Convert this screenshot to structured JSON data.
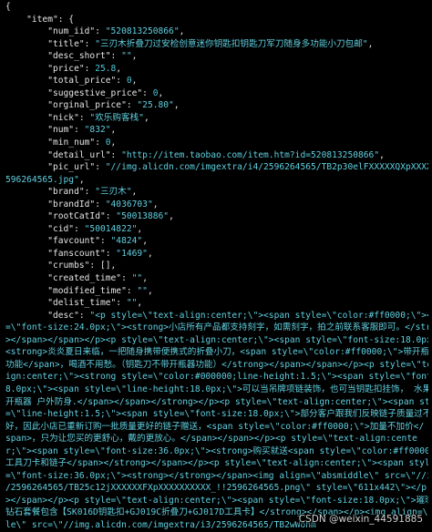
{
  "code_lines": [
    {
      "segs": [
        {
          "t": "{",
          "c": ""
        }
      ]
    },
    {
      "segs": [
        {
          "t": "    \"item\": {",
          "c": ""
        }
      ]
    },
    {
      "segs": [
        {
          "t": "        \"num_iid\": ",
          "c": ""
        },
        {
          "t": "\"520813250866\"",
          "c": "c-str"
        },
        {
          "t": ",",
          "c": ""
        }
      ]
    },
    {
      "segs": [
        {
          "t": "        \"title\": ",
          "c": ""
        },
        {
          "t": "\"三刃木折叠刀过安检创意迷你钥匙扣钥匙刀军刀随身多功能小刀包邮\"",
          "c": "c-str"
        },
        {
          "t": ",",
          "c": ""
        }
      ]
    },
    {
      "segs": [
        {
          "t": "        \"desc_short\": ",
          "c": ""
        },
        {
          "t": "\"\"",
          "c": "c-str"
        },
        {
          "t": ",",
          "c": ""
        }
      ]
    },
    {
      "segs": [
        {
          "t": "        \"price\": ",
          "c": ""
        },
        {
          "t": "25.8",
          "c": "c-num"
        },
        {
          "t": ",",
          "c": ""
        }
      ]
    },
    {
      "segs": [
        {
          "t": "        \"total_price\": ",
          "c": ""
        },
        {
          "t": "0",
          "c": "c-num"
        },
        {
          "t": ",",
          "c": ""
        }
      ]
    },
    {
      "segs": [
        {
          "t": "        \"suggestive_price\": ",
          "c": ""
        },
        {
          "t": "0",
          "c": "c-num"
        },
        {
          "t": ",",
          "c": ""
        }
      ]
    },
    {
      "segs": [
        {
          "t": "        \"orginal_price\": ",
          "c": ""
        },
        {
          "t": "\"25.80\"",
          "c": "c-str"
        },
        {
          "t": ",",
          "c": ""
        }
      ]
    },
    {
      "segs": [
        {
          "t": "        \"nick\": ",
          "c": ""
        },
        {
          "t": "\"欢乐购客栈\"",
          "c": "c-str"
        },
        {
          "t": ",",
          "c": ""
        }
      ]
    },
    {
      "segs": [
        {
          "t": "        \"num\": ",
          "c": ""
        },
        {
          "t": "\"832\"",
          "c": "c-str"
        },
        {
          "t": ",",
          "c": ""
        }
      ]
    },
    {
      "segs": [
        {
          "t": "        \"min_num\": ",
          "c": ""
        },
        {
          "t": "0",
          "c": "c-num"
        },
        {
          "t": ",",
          "c": ""
        }
      ]
    },
    {
      "segs": [
        {
          "t": "        \"detail_url\": ",
          "c": ""
        },
        {
          "t": "\"http://item.taobao.com/item.htm?id=520813250866\"",
          "c": "c-str"
        },
        {
          "t": ",",
          "c": ""
        }
      ]
    },
    {
      "segs": [
        {
          "t": "        \"pic_url\": ",
          "c": ""
        },
        {
          "t": "\"//img.alicdn.com/imgextra/i4/2596264565/TB2p30elFXXXXXQXpXXXXXXXXXX_!!2",
          "c": "c-str"
        }
      ]
    },
    {
      "segs": [
        {
          "t": "596264565.jpg\"",
          "c": "c-str"
        },
        {
          "t": ",",
          "c": ""
        }
      ]
    },
    {
      "segs": [
        {
          "t": "        \"brand\": ",
          "c": ""
        },
        {
          "t": "\"三刃木\"",
          "c": "c-str"
        },
        {
          "t": ",",
          "c": ""
        }
      ]
    },
    {
      "segs": [
        {
          "t": "        \"brandId\": ",
          "c": ""
        },
        {
          "t": "\"4036703\"",
          "c": "c-str"
        },
        {
          "t": ",",
          "c": ""
        }
      ]
    },
    {
      "segs": [
        {
          "t": "        \"rootCatId\": ",
          "c": ""
        },
        {
          "t": "\"50013886\"",
          "c": "c-str"
        },
        {
          "t": ",",
          "c": ""
        }
      ]
    },
    {
      "segs": [
        {
          "t": "        \"cid\": ",
          "c": ""
        },
        {
          "t": "\"50014822\"",
          "c": "c-str"
        },
        {
          "t": ",",
          "c": ""
        }
      ]
    },
    {
      "segs": [
        {
          "t": "        \"favcount\": ",
          "c": ""
        },
        {
          "t": "\"4824\"",
          "c": "c-str"
        },
        {
          "t": ",",
          "c": ""
        }
      ]
    },
    {
      "segs": [
        {
          "t": "        \"fanscount\": ",
          "c": ""
        },
        {
          "t": "\"1469\"",
          "c": "c-str"
        },
        {
          "t": ",",
          "c": ""
        }
      ]
    },
    {
      "segs": [
        {
          "t": "        \"crumbs\": [],",
          "c": ""
        }
      ]
    },
    {
      "segs": [
        {
          "t": "        \"created_time\": ",
          "c": ""
        },
        {
          "t": "\"\"",
          "c": "c-str"
        },
        {
          "t": ",",
          "c": ""
        }
      ]
    },
    {
      "segs": [
        {
          "t": "        \"modified_time\": ",
          "c": ""
        },
        {
          "t": "\"\"",
          "c": "c-str"
        },
        {
          "t": ",",
          "c": ""
        }
      ]
    },
    {
      "segs": [
        {
          "t": "        \"delist_time\": ",
          "c": ""
        },
        {
          "t": "\"\"",
          "c": "c-str"
        },
        {
          "t": ",",
          "c": ""
        }
      ]
    },
    {
      "segs": [
        {
          "t": "        \"desc\": ",
          "c": ""
        },
        {
          "t": "\"<p style=\\\"text-align:center;\\\"><span style=\\\"color:#ff0000;\\\"><span style",
          "c": "c-str"
        }
      ]
    },
    {
      "segs": [
        {
          "t": "=\\\"font-size:24.0px;\\\"><strong>小店所有产品都支持刻字，如需刻字，拍之前联系客服即可。</strong",
          "c": "c-str"
        }
      ]
    },
    {
      "segs": [
        {
          "t": "></span></span></p><p style=\\\"text-align:center;\\\"><span style=\\\"font-size:18.0px;\\\"><span>",
          "c": "c-str"
        }
      ]
    },
    {
      "segs": [
        {
          "t": "<strong>炎炎夏日来临，一把随身携带便携式的折叠小刀，<span style=\\\"color:#ff0000;\\\">带开瓶器",
          "c": "c-str"
        }
      ]
    },
    {
      "segs": [
        {
          "t": "功能</span>，喝酒不用愁。（钥匙刀不带开瓶器功能）</strong></span></span></p><p style=\\\"text-al",
          "c": "c-str"
        }
      ]
    },
    {
      "segs": [
        {
          "t": "ign:center;\\\"><strong style=\\\"color:#000000;line-height:1.5;\\\"><span style=\\\"font-size:1",
          "c": "c-str"
        }
      ]
    },
    {
      "segs": [
        {
          "t": "8.0px;\\\"><span style=\\\"line-height:18.0px;\\\">可以当吊牌项链装饰，也可当钥匙扣挂饰， 水果刀",
          "c": "c-str"
        }
      ]
    },
    {
      "segs": [
        {
          "t": "开瓶器 户外防身.</span></span></strong></p><p style=\\\"text-align:center;\\\"><span style",
          "c": "c-str"
        }
      ]
    },
    {
      "segs": [
        {
          "t": "=\\\"line-height:1.5;\\\"><span style=\\\"font-size:18.0px;\\\">部分客户跟我们反映链子质量过不够",
          "c": "c-str"
        }
      ]
    },
    {
      "segs": [
        {
          "t": "好，因此小店已重新订购一批质量更好的链子赠送，<span style=\\\"color:#ff0000;\\\">加量不加价</",
          "c": "c-str"
        }
      ]
    },
    {
      "segs": [
        {
          "t": "span>，只为让您买的更舒心，戴的更放心。</span></span></p><p style=\\\"text-align:cente",
          "c": "c-str"
        }
      ]
    },
    {
      "segs": [
        {
          "t": "r;\\\"><span style=\\\"font-size:36.0px;\\\"><strong>购买就送<span style=\\\"color:#ff0000;\\\">",
          "c": "c-str"
        }
      ]
    },
    {
      "segs": [
        {
          "t": "工具刀卡和链子</span></strong></span></p><p style=\\\"text-align:center;\\\"><span style",
          "c": "c-str"
        }
      ]
    },
    {
      "segs": [
        {
          "t": "=\\\"font-size:36.0px;\\\"><strong></strong></span><img align=\\\"absmiddle\\\" src=\\\"//img.alicdn.com/imgextra/i3",
          "c": "c-str"
        }
      ]
    },
    {
      "segs": [
        {
          "t": "/2596264565/TB25c12jXXXXXXFXpXXXXXXXXXX_!!2596264565.png\\\" style=\\\"611x442\\\"></p",
          "c": "c-str"
        }
      ]
    },
    {
      "segs": [
        {
          "t": "></span></p><p style=\\\"text-align:center;\\\"><span style=\\\"font-size:18.0px;\\\">璀璨",
          "c": "c-str"
        }
      ]
    },
    {
      "segs": [
        {
          "t": "钻石套餐包含【SK016D钥匙扣+GJ019C折叠刀+GJ017D工具卡】</strong></span></p><img align=\\\"absmidd",
          "c": "c-str"
        }
      ]
    },
    {
      "segs": [
        {
          "t": "le\\\" src=\\\"//img.alicdn.com/imgextra/i3/2596264565/TB2wWohm",
          "c": "c-str"
        }
      ]
    }
  ],
  "watermark": "CSDN @weixin_44591885"
}
